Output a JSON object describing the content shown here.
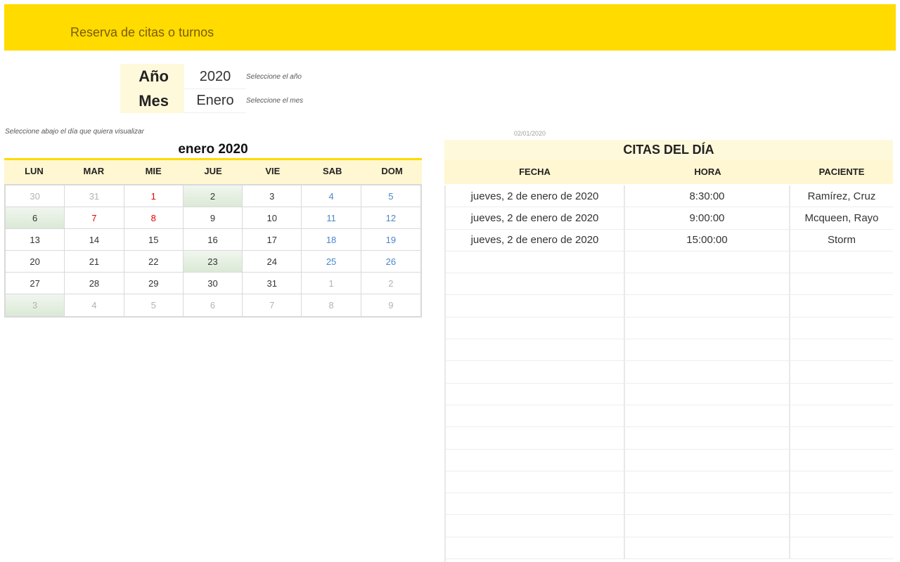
{
  "header": {
    "title": "Reserva de citas o turnos"
  },
  "selectors": {
    "year": {
      "label": "Año",
      "value": "2020",
      "hint": "Seleccione el año"
    },
    "month": {
      "label": "Mes",
      "value": "Enero",
      "hint": "Seleccione el mes"
    }
  },
  "calendar": {
    "hint": "Seleccione abajo el día que quiera visualizar",
    "title": "enero 2020",
    "weekdays": [
      "LUN",
      "MAR",
      "MIE",
      "JUE",
      "VIE",
      "SAB",
      "DOM"
    ],
    "weeks": [
      [
        {
          "d": "30",
          "t": "other"
        },
        {
          "d": "31",
          "t": "other"
        },
        {
          "d": "1",
          "t": "holiday"
        },
        {
          "d": "2",
          "t": "normal",
          "hl": true
        },
        {
          "d": "3",
          "t": "normal"
        },
        {
          "d": "4",
          "t": "weekend"
        },
        {
          "d": "5",
          "t": "weekend"
        }
      ],
      [
        {
          "d": "6",
          "t": "normal",
          "hl": true
        },
        {
          "d": "7",
          "t": "holiday"
        },
        {
          "d": "8",
          "t": "holiday"
        },
        {
          "d": "9",
          "t": "normal"
        },
        {
          "d": "10",
          "t": "normal"
        },
        {
          "d": "11",
          "t": "weekend"
        },
        {
          "d": "12",
          "t": "weekend"
        }
      ],
      [
        {
          "d": "13",
          "t": "normal"
        },
        {
          "d": "14",
          "t": "normal"
        },
        {
          "d": "15",
          "t": "normal"
        },
        {
          "d": "16",
          "t": "normal"
        },
        {
          "d": "17",
          "t": "normal"
        },
        {
          "d": "18",
          "t": "weekend"
        },
        {
          "d": "19",
          "t": "weekend"
        }
      ],
      [
        {
          "d": "20",
          "t": "normal"
        },
        {
          "d": "21",
          "t": "normal"
        },
        {
          "d": "22",
          "t": "normal"
        },
        {
          "d": "23",
          "t": "normal",
          "hl": true
        },
        {
          "d": "24",
          "t": "normal"
        },
        {
          "d": "25",
          "t": "weekend"
        },
        {
          "d": "26",
          "t": "weekend"
        }
      ],
      [
        {
          "d": "27",
          "t": "normal"
        },
        {
          "d": "28",
          "t": "normal"
        },
        {
          "d": "29",
          "t": "normal"
        },
        {
          "d": "30",
          "t": "normal"
        },
        {
          "d": "31",
          "t": "normal"
        },
        {
          "d": "1",
          "t": "other"
        },
        {
          "d": "2",
          "t": "other"
        }
      ],
      [
        {
          "d": "3",
          "t": "other",
          "hl": true
        },
        {
          "d": "4",
          "t": "other"
        },
        {
          "d": "5",
          "t": "other"
        },
        {
          "d": "6",
          "t": "other"
        },
        {
          "d": "7",
          "t": "other"
        },
        {
          "d": "8",
          "t": "other"
        },
        {
          "d": "9",
          "t": "other"
        }
      ]
    ]
  },
  "appointments": {
    "selected_date": "02/01/2020",
    "title": "CITAS DEL DÍA",
    "columns": [
      "FECHA",
      "HORA",
      "PACIENTE"
    ],
    "rows": [
      [
        "jueves, 2 de enero de 2020",
        "8:30:00",
        "Ramírez, Cruz"
      ],
      [
        "jueves, 2 de enero de 2020",
        "9:00:00",
        "Mcqueen, Rayo"
      ],
      [
        "jueves, 2 de enero de 2020",
        "15:00:00",
        "Storm"
      ],
      [
        "",
        "",
        ""
      ],
      [
        "",
        "",
        ""
      ],
      [
        "",
        "",
        ""
      ],
      [
        "",
        "",
        ""
      ],
      [
        "",
        "",
        ""
      ],
      [
        "",
        "",
        ""
      ],
      [
        "",
        "",
        ""
      ],
      [
        "",
        "",
        ""
      ],
      [
        "",
        "",
        ""
      ],
      [
        "",
        "",
        ""
      ],
      [
        "",
        "",
        ""
      ],
      [
        "",
        "",
        ""
      ],
      [
        "",
        "",
        ""
      ],
      [
        "",
        "",
        ""
      ]
    ]
  },
  "colors": {
    "accent": "#FFDB00",
    "header_fill": "#FFF6D2",
    "holiday": "#e00000",
    "weekend": "#4a86c8"
  }
}
